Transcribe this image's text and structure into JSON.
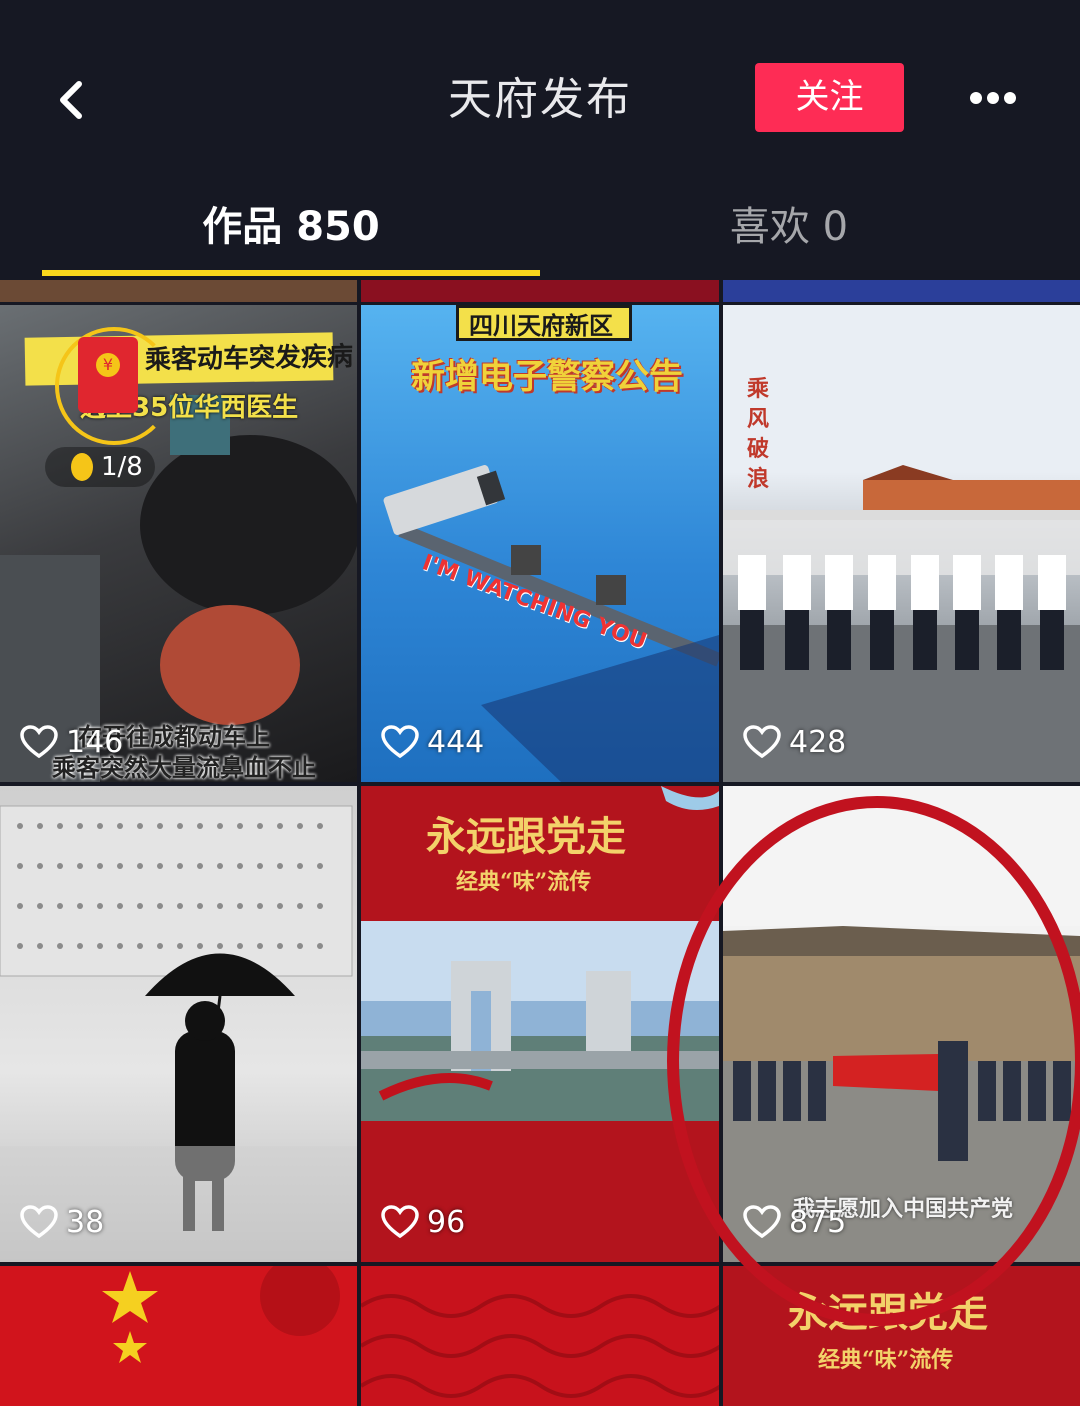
{
  "header": {
    "title": "天府发布",
    "follow_label": "关注"
  },
  "tabs": [
    {
      "label": "作品 850",
      "active": true
    },
    {
      "label": "喜欢 0",
      "active": false
    }
  ],
  "colors": {
    "background": "#161823",
    "follow": "#fe2c55",
    "tab_indicator": "#f9d71c",
    "annotation_circle": "#c1121f"
  },
  "grid": {
    "videos": [
      {
        "likes": "146",
        "overlay_top_1": "乘客动车突发疾病",
        "overlay_top_2": "遇上35位华西医生",
        "redpacket_progress": "1/8",
        "caption_1": "在开往成都动车上",
        "caption_2": "乘客突然大量流鼻血不止"
      },
      {
        "likes": "444",
        "overlay_top_1": "四川天府新区",
        "overlay_top_2": "新增电子警察公告",
        "overlay_mid": "I'M WATCHING YOU"
      },
      {
        "likes": "428",
        "overlay_vertical": "乘风破浪"
      },
      {
        "likes": "38"
      },
      {
        "likes": "96",
        "overlay_top_1": "永远跟党走",
        "overlay_top_2": "经典“味”流传"
      },
      {
        "likes": "875",
        "caption_1": "我志愿加入中国共产党"
      }
    ],
    "partial_bottom": [
      {
        "overlay": ""
      },
      {
        "overlay": ""
      },
      {
        "overlay_top_1": "永远跟党走",
        "overlay_top_2": "经典“味”流传"
      }
    ]
  }
}
